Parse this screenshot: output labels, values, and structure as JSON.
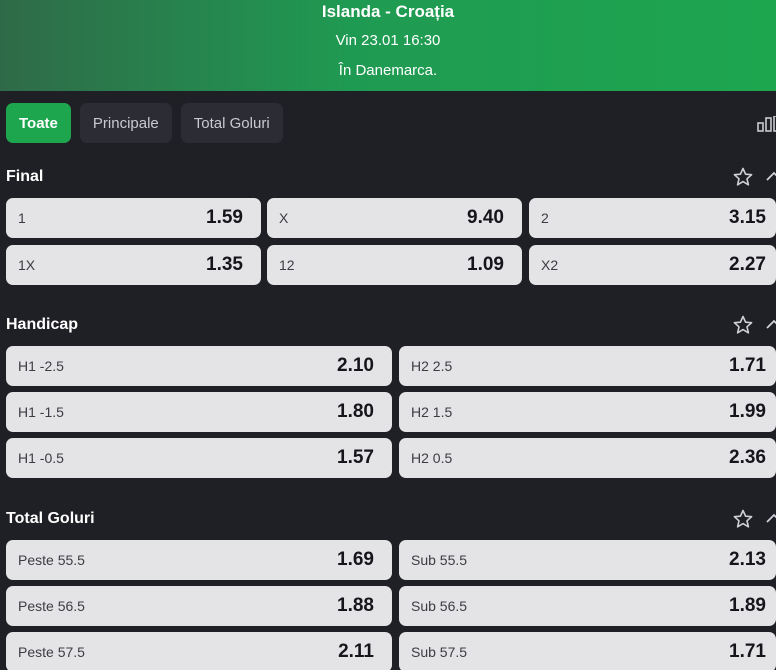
{
  "header": {
    "title": "Islanda - Croația",
    "datetime": "Vin 23.01 16:30",
    "venue": "În Danemarca."
  },
  "tabs": [
    {
      "label": "Toate",
      "active": true
    },
    {
      "label": "Principale",
      "active": false
    },
    {
      "label": "Total Goluri",
      "active": false
    }
  ],
  "icons": {
    "stats": "bar-chart-icon",
    "favorite": "star-outline-icon",
    "collapse": "chevron-up-icon"
  },
  "colors": {
    "accent": "#1ea64f",
    "background": "#1f1f26",
    "odd_button": "#e4e4e6"
  },
  "markets": {
    "final": {
      "title": "Final",
      "odds": [
        {
          "label": "1",
          "value": "1.59"
        },
        {
          "label": "X",
          "value": "9.40"
        },
        {
          "label": "2",
          "value": "3.15"
        },
        {
          "label": "1X",
          "value": "1.35"
        },
        {
          "label": "12",
          "value": "1.09"
        },
        {
          "label": "X2",
          "value": "2.27"
        }
      ]
    },
    "handicap": {
      "title": "Handicap",
      "odds": [
        {
          "label": "H1 -2.5",
          "value": "2.10"
        },
        {
          "label": "H2 2.5",
          "value": "1.71"
        },
        {
          "label": "H1 -1.5",
          "value": "1.80"
        },
        {
          "label": "H2 1.5",
          "value": "1.99"
        },
        {
          "label": "H1 -0.5",
          "value": "1.57"
        },
        {
          "label": "H2 0.5",
          "value": "2.36"
        }
      ]
    },
    "total_goluri": {
      "title": "Total Goluri",
      "odds": [
        {
          "label": "Peste 55.5",
          "value": "1.69"
        },
        {
          "label": "Sub 55.5",
          "value": "2.13"
        },
        {
          "label": "Peste 56.5",
          "value": "1.88"
        },
        {
          "label": "Sub 56.5",
          "value": "1.89"
        },
        {
          "label": "Peste 57.5",
          "value": "2.11"
        },
        {
          "label": "Sub 57.5",
          "value": "1.71"
        }
      ]
    }
  }
}
